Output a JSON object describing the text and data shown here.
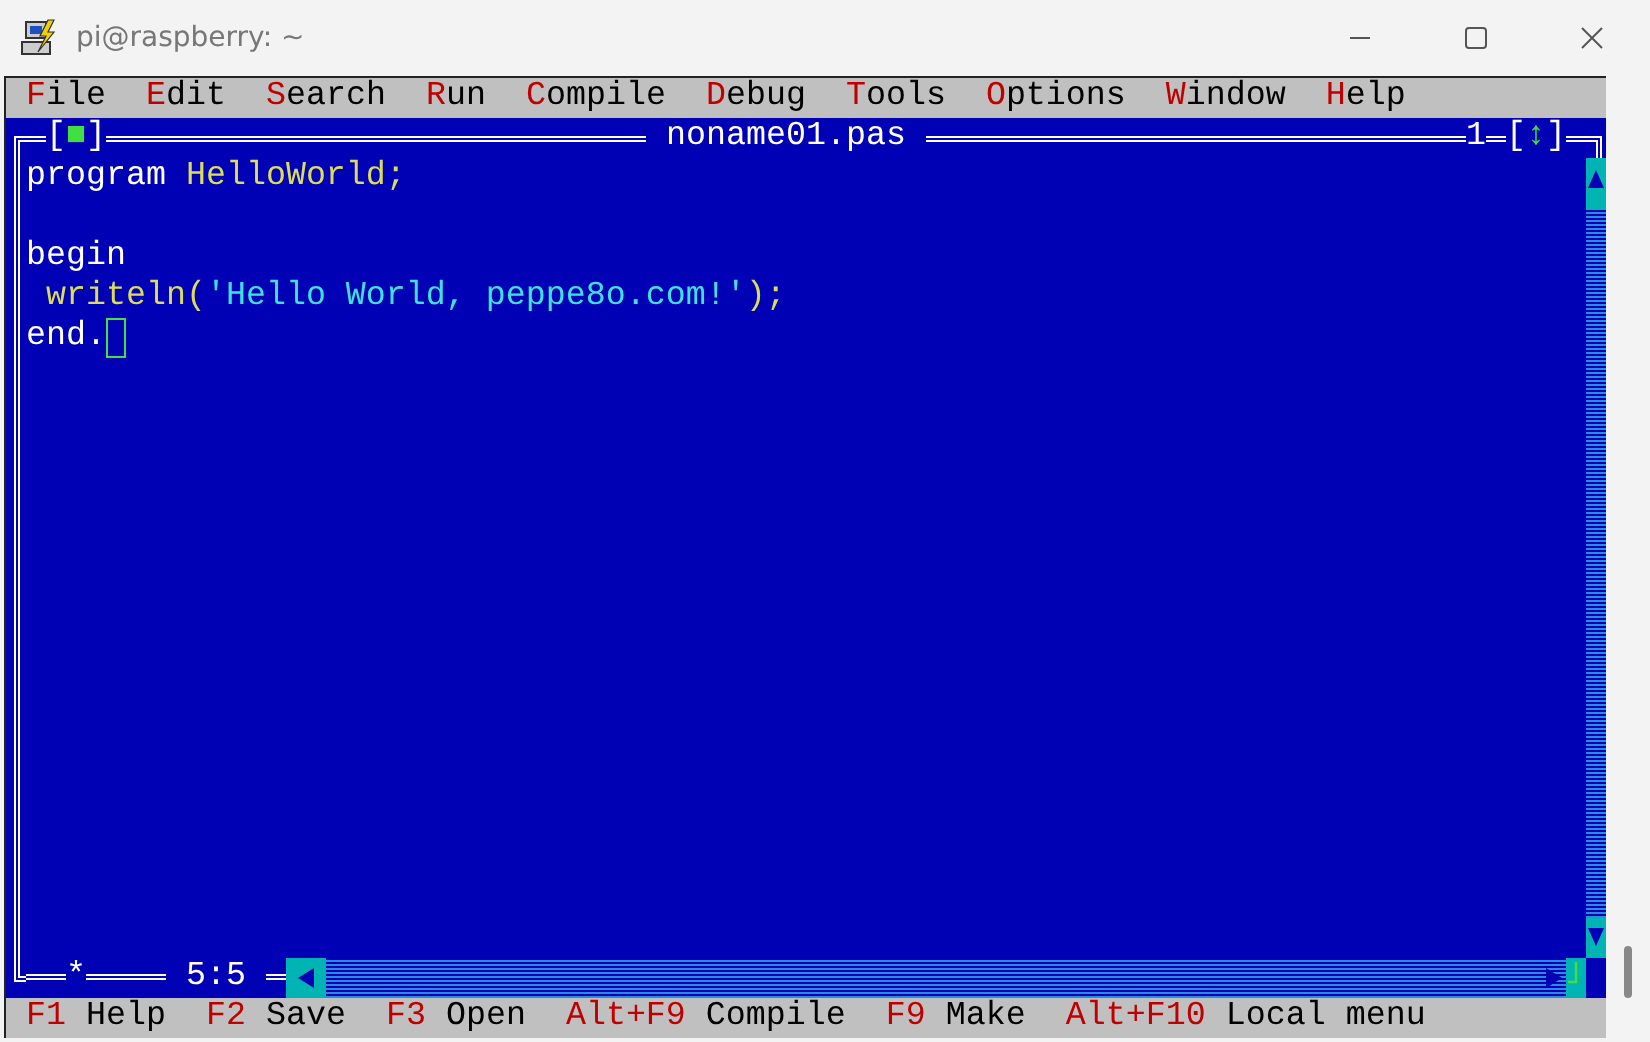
{
  "window": {
    "title": "pi@raspberry: ~"
  },
  "menu": [
    {
      "label": "File"
    },
    {
      "label": "Edit"
    },
    {
      "label": "Search"
    },
    {
      "label": "Run"
    },
    {
      "label": "Compile"
    },
    {
      "label": "Debug"
    },
    {
      "label": "Tools"
    },
    {
      "label": "Options"
    },
    {
      "label": "Window"
    },
    {
      "label": "Help"
    }
  ],
  "editor": {
    "close_button": "[■]",
    "title": "noname01.pas",
    "window_number": "1",
    "zoom_button": "[↕]",
    "modified_mark": "*",
    "position": "5:5",
    "lines": [
      {
        "kind": "code",
        "cursor": false,
        "tokens": [
          {
            "kind": "keyword",
            "text": "program "
          },
          {
            "kind": "identifier",
            "text": "HelloWorld;"
          }
        ]
      },
      {
        "kind": "blank",
        "cursor": false
      },
      {
        "kind": "code",
        "cursor": false,
        "tokens": [
          {
            "kind": "keyword",
            "text": "begin"
          }
        ]
      },
      {
        "kind": "code",
        "cursor": false,
        "tokens": [
          {
            "kind": "identifier",
            "text": " writeln("
          },
          {
            "kind": "string",
            "text": "'Hello World, peppe8o.com!'"
          },
          {
            "kind": "identifier",
            "text": ");"
          }
        ]
      },
      {
        "kind": "code",
        "cursor": true,
        "tokens": [
          {
            "kind": "keyword",
            "text": "end."
          }
        ]
      }
    ]
  },
  "status_bar": [
    {
      "key": "F1",
      "label": "Help"
    },
    {
      "key": "F2",
      "label": "Save"
    },
    {
      "key": "F3",
      "label": "Open"
    },
    {
      "key": "Alt+F9",
      "label": "Compile"
    },
    {
      "key": "F9",
      "label": "Make"
    },
    {
      "key": "Alt+F10",
      "label": "Local menu"
    }
  ]
}
